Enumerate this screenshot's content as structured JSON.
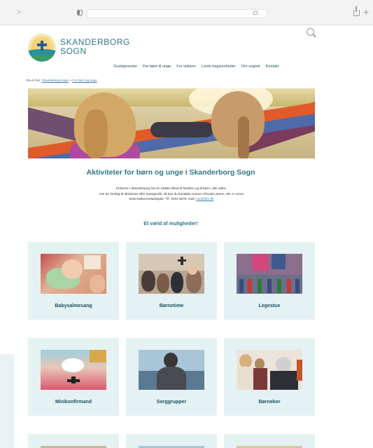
{
  "browser": {
    "back_glyph": ">",
    "new_tab_glyph": "+"
  },
  "site": {
    "brand_line1": "SKANDERBORG",
    "brand_line2": "SOGN"
  },
  "nav": {
    "items": [
      {
        "label": "Gudstjenester"
      },
      {
        "label": "For børn & unge"
      },
      {
        "label": "For voksne"
      },
      {
        "label": "Livets begivenheder"
      },
      {
        "label": "Om sognet"
      },
      {
        "label": "Kontakt"
      }
    ]
  },
  "breadcrumb": {
    "prefix": "Du er her:",
    "home": "Skanderborg Sogn",
    "separator": "»",
    "current": "For børn og unge"
  },
  "page": {
    "title": "Aktiviteter for børn og unge i Skanderborg Sogn",
    "intro_line1": "Kirkerne i Skanderborg har en række tilbud til familien og til børn i alle aldre.",
    "intro_line2": "Har du forslag til aktiviteter eller spørgsmål, så kan du kontakte Hanne Orhvad-Larsen, der er vores",
    "intro_line3": "kirke-kulturmedarbejder: Tlf. 3031 5075, mail:",
    "intro_email": "hao@km.dk",
    "subtitle": "Et væld af muligheder!"
  },
  "cards": [
    {
      "label": "Babysalmesang"
    },
    {
      "label": "Børnetime"
    },
    {
      "label": "Legestue"
    },
    {
      "label": "Minikonfirmand"
    },
    {
      "label": "Sorggrupper"
    },
    {
      "label": "Børnekor"
    }
  ],
  "icons": {
    "search": "search-icon",
    "shield": "shield-icon",
    "lock": "lock-icon",
    "share": "share-icon"
  },
  "colors": {
    "brand": "#2e7686",
    "card_bg": "#e4f2f4",
    "nav_text": "#1f4f5d",
    "link": "#3a80a8"
  }
}
